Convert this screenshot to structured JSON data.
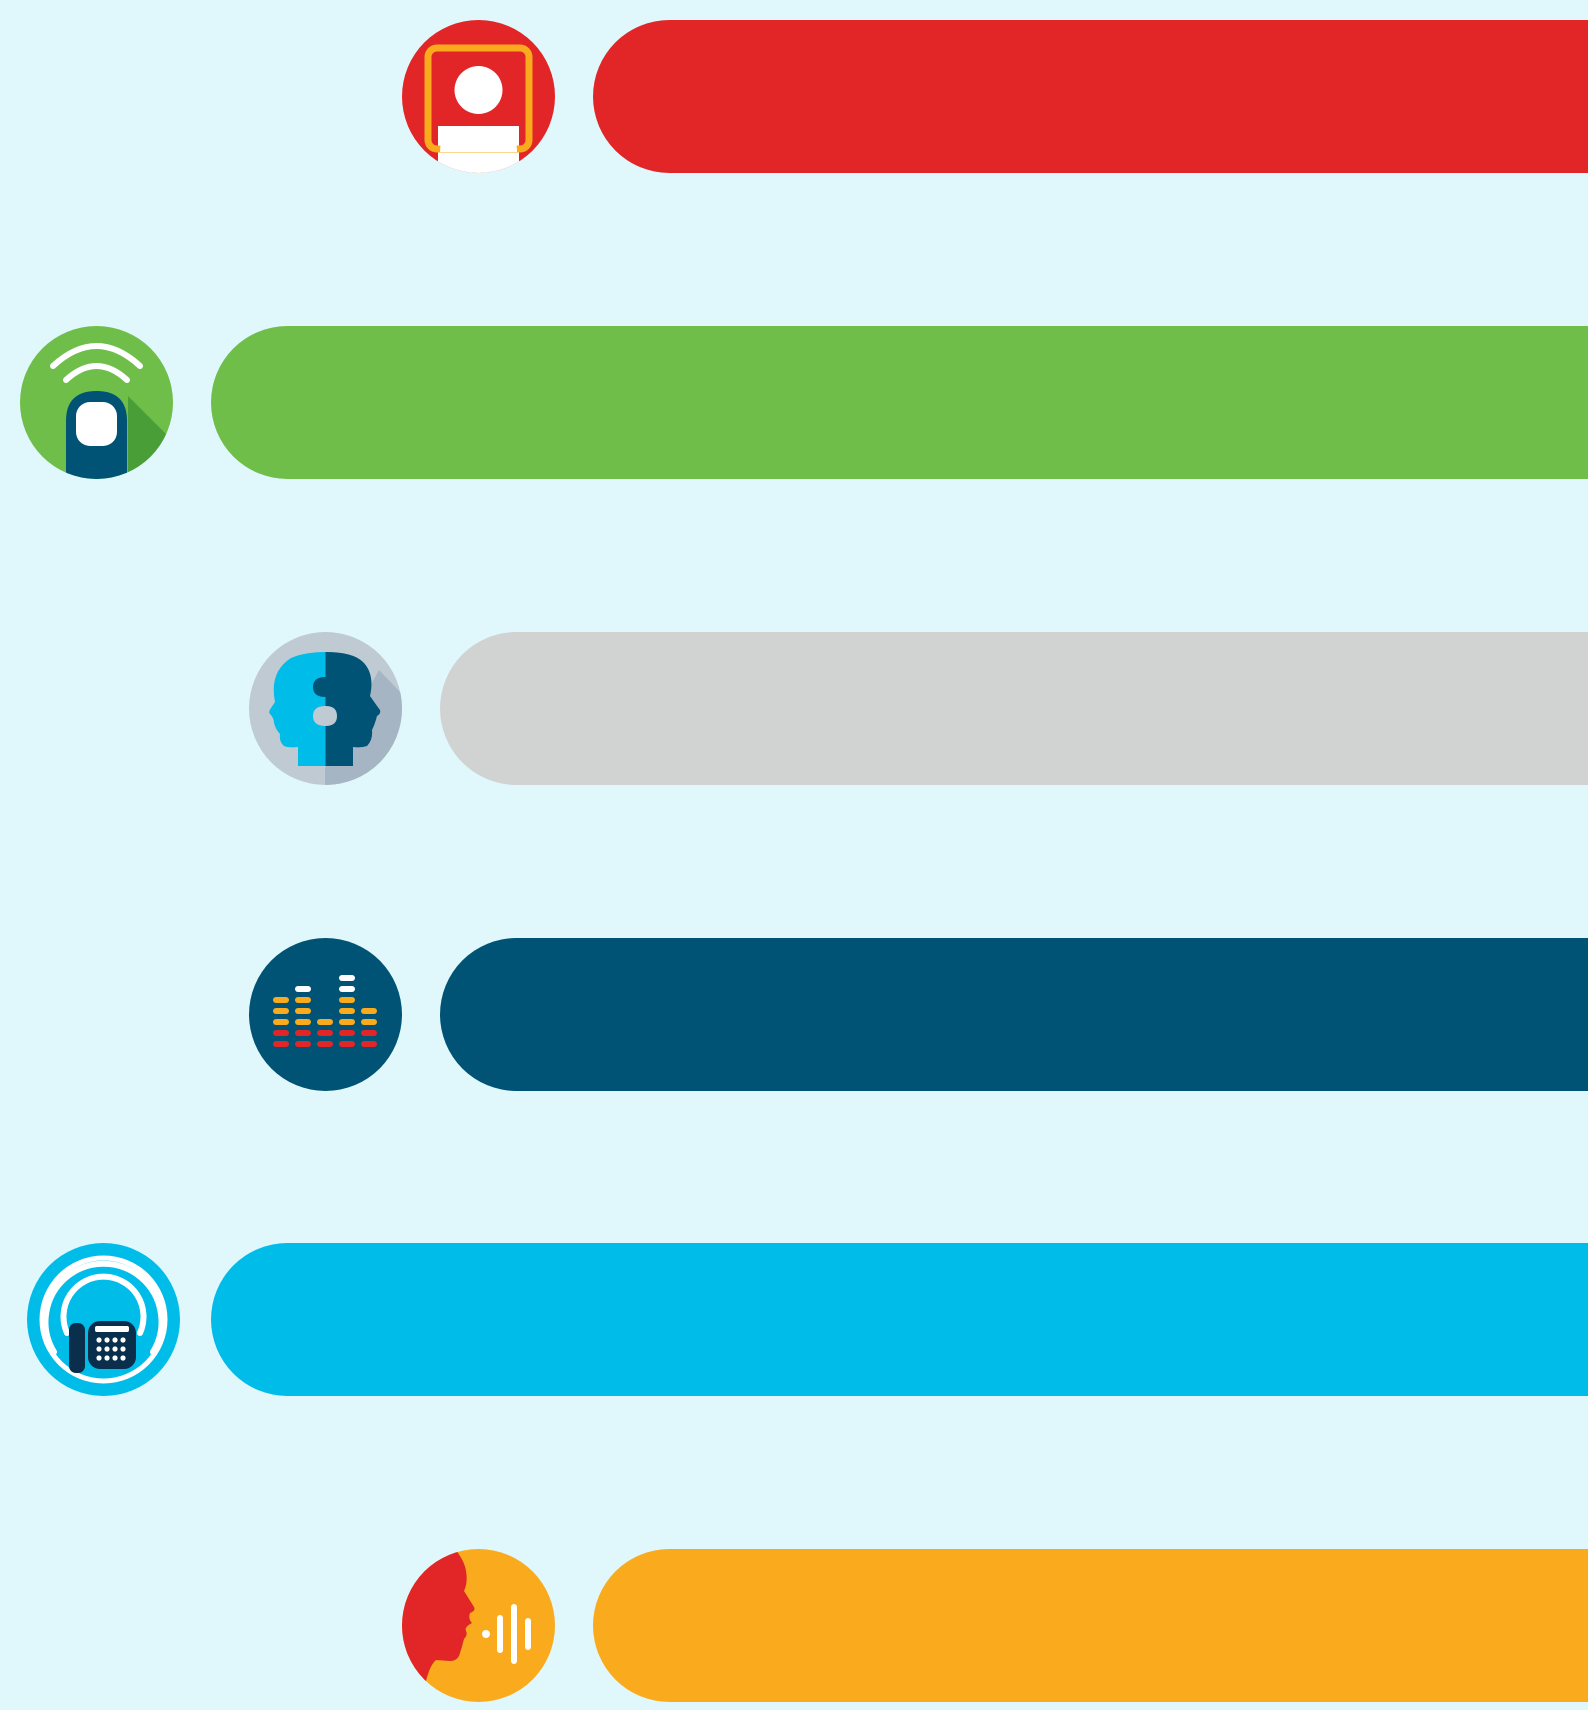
{
  "rows": [
    {
      "icon": "user-profile-icon",
      "bar_color": "#e22526",
      "icon_bg": "#e22526"
    },
    {
      "icon": "touch-signal-icon",
      "bar_color": "#6fbe4a",
      "icon_bg": "#6fbe4a"
    },
    {
      "icon": "puzzle-heads-icon",
      "bar_color": "#d1d3d2",
      "icon_bg": "#bfcad3"
    },
    {
      "icon": "audio-equalizer-icon",
      "bar_color": "#005375",
      "icon_bg": "#005375"
    },
    {
      "icon": "phone-signal-icon",
      "bar_color": "#00bce9",
      "icon_bg": "#00bce9"
    },
    {
      "icon": "voice-speech-icon",
      "bar_color": "#f9ab1d",
      "icon_bg": "#f9ab1d"
    }
  ]
}
